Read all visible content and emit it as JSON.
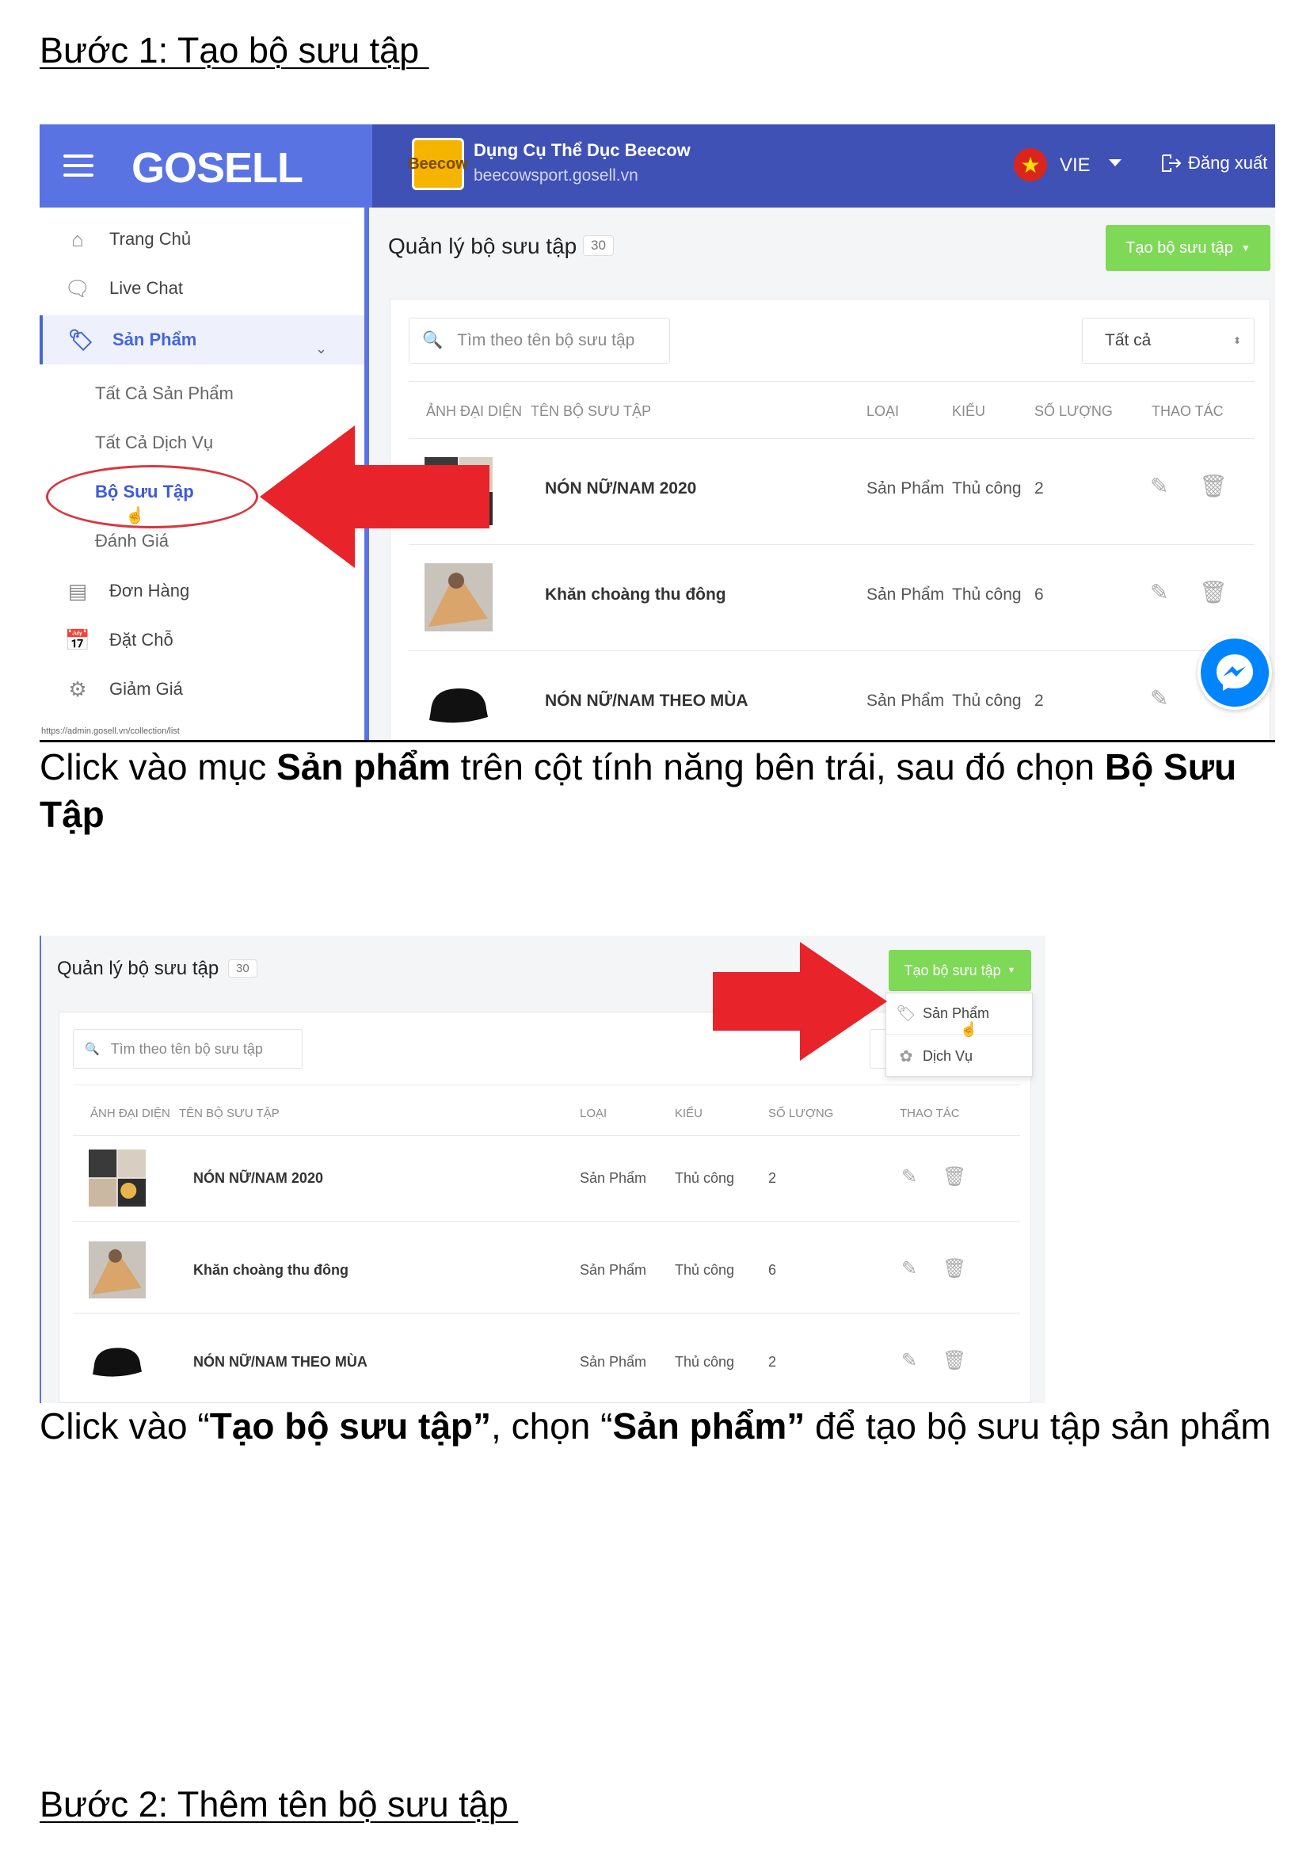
{
  "doc": {
    "step1_heading": "Bước 1: Tạo bộ sưu tập ",
    "step1_caption": {
      "p1": "Click vào mục ",
      "b1": "Sản phẩm",
      "p2": " trên cột tính năng bên trái, sau đó chọn ",
      "b2": "Bộ Sưu Tập"
    },
    "step2_caption": {
      "p1": "Click vào “",
      "b1": "Tạo bộ sưu tập”",
      "p2": ", chọn “",
      "b2": "Sản phẩm”",
      "p3": " để tạo bộ sưu tập sản phẩm"
    },
    "step2_heading": "Bước 2: Thêm tên bộ sưu tập "
  },
  "shot1": {
    "logo": "GOSELL",
    "shop_name": "Dụng Cụ Thể Dục Beecow",
    "shop_url": "beecowsport.gosell.vn",
    "shop_logo_text": "Beecow",
    "language": "VIE",
    "logout": "Đăng xuất",
    "sidebar": {
      "home": "Trang Chủ",
      "live_chat": "Live Chat",
      "products": "Sản Phẩm",
      "all_products": "Tất Cả Sản Phẩm",
      "all_services": "Tất Cả Dịch Vụ",
      "collections": "Bộ Sưu Tập",
      "reviews": "Đánh Giá",
      "orders": "Đơn Hàng",
      "booking": "Đặt Chỗ",
      "discounts": "Giảm Giá"
    },
    "status_url": "https://admin.gosell.vn/collection/list",
    "page_title": "Quản lý bộ sưu tập",
    "count": "30",
    "create_button": "Tạo bộ sưu tập",
    "search_placeholder": "Tìm theo tên bộ sưu tập",
    "filter_value": "Tất cả",
    "columns": {
      "image": "ẢNH ĐẠI DIỆN",
      "name": "TÊN BỘ SƯU TẬP",
      "type": "LOẠI",
      "mode": "KIỂU",
      "qty": "SỐ LƯỢNG",
      "actions": "THAO TÁC"
    },
    "rows": [
      {
        "name": "NÓN NỮ/NAM 2020",
        "type": "Sản Phẩm",
        "mode": "Thủ công",
        "qty": "2"
      },
      {
        "name": "Khăn choàng thu đông",
        "type": "Sản Phẩm",
        "mode": "Thủ công",
        "qty": "6"
      },
      {
        "name": "NÓN NỮ/NAM THEO MÙA",
        "type": "Sản Phẩm",
        "mode": "Thủ công",
        "qty": "2"
      }
    ]
  },
  "shot2": {
    "page_title": "Quản lý bộ sưu tập",
    "count": "30",
    "create_button": "Tạo bộ sưu tập",
    "menu": {
      "products": "Sản Phẩm",
      "services": "Dịch Vụ"
    },
    "search_placeholder": "Tìm theo tên bộ sưu tập",
    "columns": {
      "image": "ẢNH ĐẠI DIỆN",
      "name": "TÊN BỘ SƯU TẬP",
      "type": "LOẠI",
      "mode": "KIỂU",
      "qty": "SỐ LƯỢNG",
      "actions": "THAO TÁC"
    },
    "rows": [
      {
        "name": "NÓN NỮ/NAM 2020",
        "type": "Sản Phẩm",
        "mode": "Thủ công",
        "qty": "2"
      },
      {
        "name": "Khăn choàng thu đông",
        "type": "Sản Phẩm",
        "mode": "Thủ công",
        "qty": "6"
      },
      {
        "name": "NÓN NỮ/NAM THEO MÙA",
        "type": "Sản Phẩm",
        "mode": "Thủ công",
        "qty": "2"
      }
    ]
  },
  "colors": {
    "brand_blue": "#3f51b5",
    "sidebar_blue": "#5a73e2",
    "create_green": "#7ed957",
    "arrow_red": "#e8232a",
    "messenger_blue": "#0084ff"
  }
}
